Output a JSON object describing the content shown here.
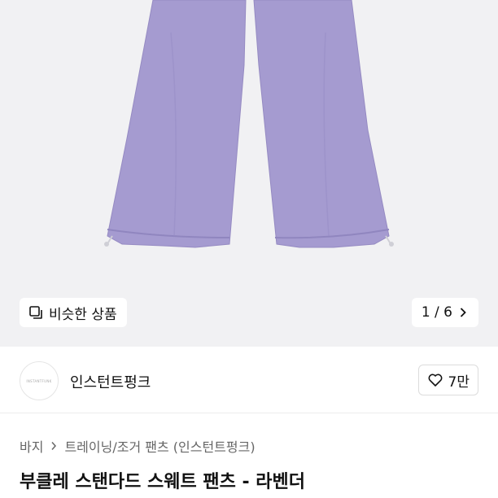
{
  "gallery": {
    "similar_label": "비슷한 상품",
    "page_indicator": "1 / 6",
    "colors": {
      "background": "#f1f1f3",
      "product": "#a59bd0"
    }
  },
  "seller": {
    "avatar_text": "INSTANTFUNK",
    "name": "인스턴트펑크",
    "like_count": "7만"
  },
  "breadcrumb": {
    "items": [
      "바지",
      "트레이닝/조거 팬츠 (인스턴트펑크)"
    ]
  },
  "product": {
    "title": "부클레 스탠다드 스웨트 팬츠 - 라벤더"
  }
}
